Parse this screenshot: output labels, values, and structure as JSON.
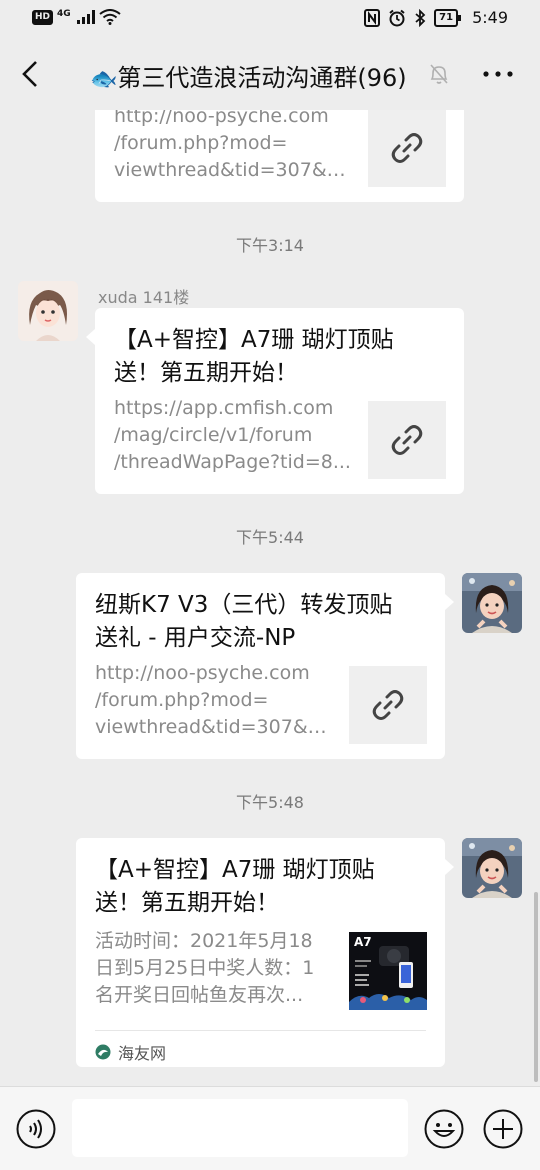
{
  "status_bar": {
    "hd": "HD",
    "network": "4G",
    "battery": "71",
    "time": "5:49"
  },
  "header": {
    "title_emoji": "🐟",
    "title": "第三代造浪活动沟通群(96)"
  },
  "messages": [
    {
      "type": "link-card-partial",
      "desc_lines": [
        "http://noo-psyche.com",
        "/forum.php?mod=",
        "viewthread&tid=307&ex..."
      ]
    },
    {
      "type": "time",
      "text": "下午3:14"
    },
    {
      "type": "link-card",
      "sender": "xuda 141楼",
      "title_lines": [
        "【A+智控】A7珊 瑚灯顶贴",
        "送！第五期开始！"
      ],
      "desc_lines": [
        "https://app.cmfish.com",
        "/mag/circle/v1/forum",
        "/threadWapPage?tid=8..."
      ]
    },
    {
      "type": "time",
      "text": "下午5:44"
    },
    {
      "type": "link-card-self",
      "title_lines": [
        "纽斯K7 V3（三代）转发顶贴",
        "送礼 - 用户交流-NP"
      ],
      "desc_lines": [
        "http://noo-psyche.com",
        "/forum.php?mod=",
        "viewthread&tid=307&ex..."
      ]
    },
    {
      "type": "time",
      "text": "下午5:48"
    },
    {
      "type": "article-card-self",
      "title_lines": [
        "【A+智控】A7珊 瑚灯顶贴",
        "送！第五期开始！"
      ],
      "desc_lines": [
        "活动时间：2021年5月18",
        "日到5月25日中奖人数：1",
        "名开奖日回帖鱼友再次..."
      ],
      "thumb_label": "A7",
      "source": "海友网"
    }
  ],
  "input": {
    "placeholder": ""
  },
  "colors": {
    "background": "#ededed",
    "bubble": "#ffffff",
    "time_text": "#7a7a7a",
    "link_gray": "#8a8a8a"
  },
  "icons": [
    "back-arrow-icon",
    "mute-bell-icon",
    "more-dots-icon",
    "link-icon",
    "voice-icon",
    "emoji-icon",
    "plus-icon"
  ]
}
